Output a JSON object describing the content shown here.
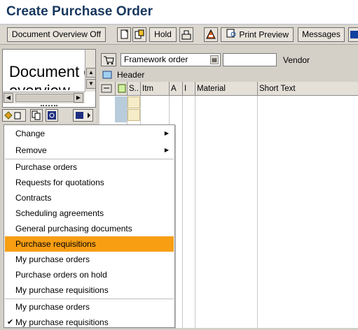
{
  "window": {
    "title": "Create Purchase Order"
  },
  "toolbar": {
    "doc_overview_label": "Document Overview Off",
    "hold_label": "Hold",
    "print_preview_label": "Print Preview",
    "messages_label": "Messages"
  },
  "overview_pane": {
    "text": "Document overview"
  },
  "header": {
    "order_type_value": "Framework order",
    "vendor_label": "Vendor",
    "vendor_value": "",
    "section_label": "Header"
  },
  "grid": {
    "columns": [
      "S..",
      "Itm",
      "A",
      "I",
      "Material",
      "Short Text"
    ]
  },
  "context_menu": {
    "items": [
      {
        "label": "Change",
        "has_submenu": true,
        "highlighted": false,
        "checked": false
      },
      {
        "label": "Remove",
        "has_submenu": true,
        "highlighted": false,
        "checked": false
      },
      {
        "label": "Purchase orders",
        "has_submenu": false,
        "highlighted": false,
        "checked": false
      },
      {
        "label": "Requests for quotations",
        "has_submenu": false,
        "highlighted": false,
        "checked": false
      },
      {
        "label": "Contracts",
        "has_submenu": false,
        "highlighted": false,
        "checked": false
      },
      {
        "label": "Scheduling agreements",
        "has_submenu": false,
        "highlighted": false,
        "checked": false
      },
      {
        "label": "General purchasing documents",
        "has_submenu": false,
        "highlighted": false,
        "checked": false
      },
      {
        "label": "Purchase requisitions",
        "has_submenu": false,
        "highlighted": true,
        "checked": false
      },
      {
        "label": "My purchase orders",
        "has_submenu": false,
        "highlighted": false,
        "checked": false
      },
      {
        "label": "Purchase orders on hold",
        "has_submenu": false,
        "highlighted": false,
        "checked": false
      },
      {
        "label": "My purchase requisitions",
        "has_submenu": false,
        "highlighted": false,
        "checked": false
      },
      {
        "label": "My purchase orders",
        "has_submenu": false,
        "highlighted": false,
        "checked": false
      },
      {
        "label": "My purchase requisitions",
        "has_submenu": false,
        "highlighted": false,
        "checked": true
      }
    ]
  },
  "colors": {
    "highlight": "#f79e13",
    "title": "#17375e"
  }
}
